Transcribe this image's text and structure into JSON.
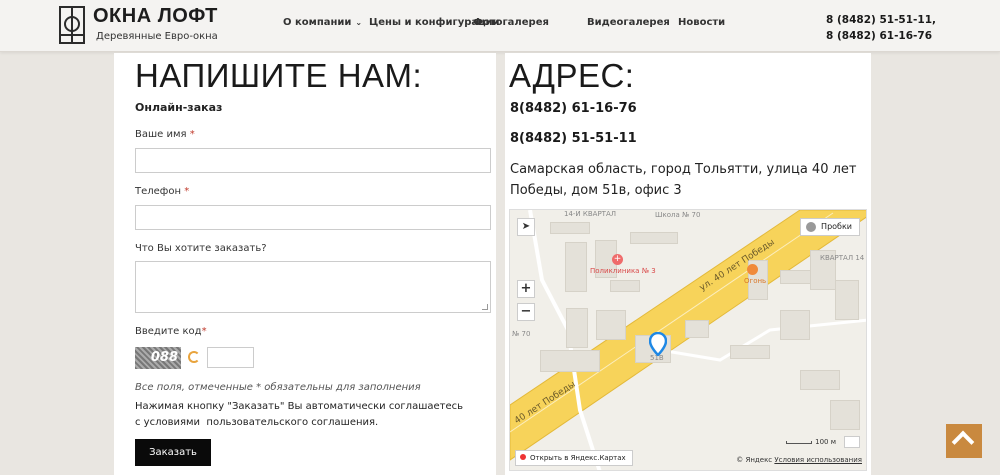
{
  "header": {
    "brand": "ОКНА ЛОФТ",
    "tagline": "Деревянные Евро-окна",
    "nav": [
      {
        "label": "О компании"
      },
      {
        "label": "Цены и конфигурации"
      },
      {
        "label": "Фотогалерея"
      },
      {
        "label": "Видеогалерея"
      },
      {
        "label": "Новости"
      }
    ],
    "phone1": "8 (8482) 51-51-11,",
    "phone2": "8 (8482) 61-16-76"
  },
  "form": {
    "title": "НАПИШИТЕ НАМ:",
    "subtitle": "Онлайн-заказ",
    "name_label": "Ваше имя",
    "phone_label": "Телефон",
    "order_label": "Что Вы хотите заказать?",
    "code_label": "Введите код",
    "required_mark": "*",
    "captcha_text": "088",
    "note": "Все поля, отмеченные * обязательны для заполнения",
    "agree_text": "Нажимая кнопку \"Заказать\" Вы автоматически соглашаетесь с условиями",
    "agree_link": "пользовательского соглашения.",
    "submit": "Заказать"
  },
  "contact": {
    "title": "АДРЕС:",
    "phone1": "8(8482) 61-16-76",
    "phone2": "8(8482) 51-51-11",
    "address": "Самарская область, город Тольятти, улица 40 лет Победы, дом 51в, офис 3"
  },
  "map": {
    "labels": {
      "kvartal14": "14-Й КВАРТАЛ",
      "school": "Школа № 70",
      "clinic": "Поликлиника № 3",
      "street": "ул. 40 лет Победы",
      "street2": "40 лет Победы",
      "shop": "Огонь",
      "kvartal_r": "КВАРТАЛ 14",
      "n70": "№ 70",
      "house": "51В"
    },
    "traffic": "Пробки",
    "open": "Открыть в Яндекс.Картах",
    "copyright": "© Яндекс",
    "terms": "Условия использования",
    "scale": "100 м",
    "zoom_in": "+",
    "zoom_out": "−"
  },
  "colors": {
    "accent": "#c9893f",
    "button": "#0a0a0a",
    "road": "#f7d35a"
  }
}
